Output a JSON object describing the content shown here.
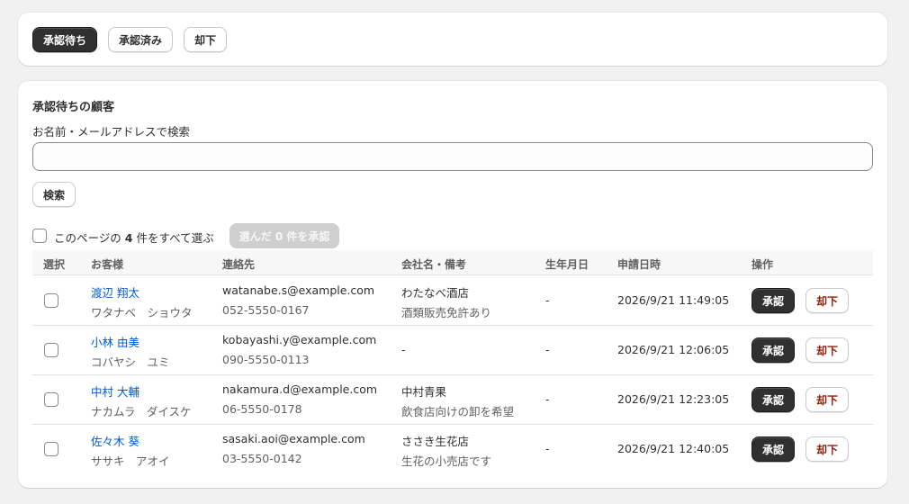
{
  "tabs": {
    "pending": "承認待ち",
    "approved": "承認済み",
    "rejected": "却下"
  },
  "main": {
    "title": "承認待ちの顧客",
    "search_label": "お名前・メールアドレスで検索",
    "search_value": "",
    "search_button": "検索",
    "select_all": {
      "prefix": "このページの",
      "count": "4",
      "suffix": "件をすべて選ぶ"
    },
    "bulk_approve_button": "選んだ 0 件を承認"
  },
  "table": {
    "headers": {
      "select": "選択",
      "customer": "お客様",
      "contact": "連絡先",
      "company": "会社名・備考",
      "birthday": "生年月日",
      "applied_at": "申請日時",
      "actions": "操作"
    },
    "rows": [
      {
        "name": "渡辺 翔太",
        "kana": "ワタナベ　ショウタ",
        "email": "watanabe.s@example.com",
        "phone": "052-5550-0167",
        "company": "わたなべ酒店",
        "note": "酒類販売免許あり",
        "birthday": "-",
        "applied_at": "2026/9/21 11:49:05",
        "approve": "承認",
        "reject": "却下"
      },
      {
        "name": "小林 由美",
        "kana": "コバヤシ　ユミ",
        "email": "kobayashi.y@example.com",
        "phone": "090-5550-0113",
        "company": "-",
        "note": "",
        "birthday": "-",
        "applied_at": "2026/9/21 12:06:05",
        "approve": "承認",
        "reject": "却下"
      },
      {
        "name": "中村 大輔",
        "kana": "ナカムラ　ダイスケ",
        "email": "nakamura.d@example.com",
        "phone": "06-5550-0178",
        "company": "中村青果",
        "note": "飲食店向けの卸を希望",
        "birthday": "-",
        "applied_at": "2026/9/21 12:23:05",
        "approve": "承認",
        "reject": "却下"
      },
      {
        "name": "佐々木 葵",
        "kana": "ササキ　アオイ",
        "email": "sasaki.aoi@example.com",
        "phone": "03-5550-0142",
        "company": "ささき生花店",
        "note": "生花の小売店です",
        "birthday": "-",
        "applied_at": "2026/9/21 12:40:05",
        "approve": "承認",
        "reject": "却下"
      }
    ]
  }
}
